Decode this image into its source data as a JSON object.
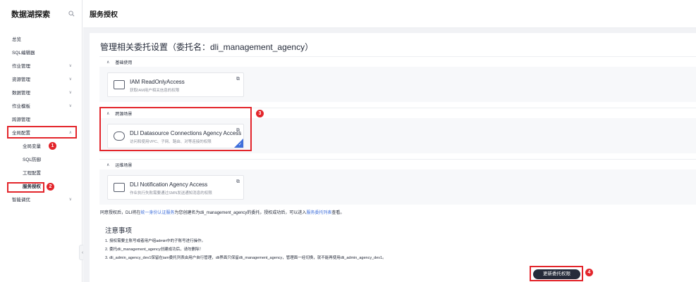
{
  "sidebar": {
    "title": "数据湖探索",
    "search_icon": "search-icon",
    "items": [
      {
        "label": "总览",
        "has_chevron": false
      },
      {
        "label": "SQL编辑器",
        "has_chevron": false
      },
      {
        "label": "作业管理",
        "has_chevron": true
      },
      {
        "label": "资源管理",
        "has_chevron": true
      },
      {
        "label": "数据管理",
        "has_chevron": true
      },
      {
        "label": "作业模板",
        "has_chevron": true
      },
      {
        "label": "跨源管理",
        "has_chevron": false
      },
      {
        "label": "全局配置",
        "has_chevron": true,
        "expanded": true
      },
      {
        "label": "全局变量",
        "sub": true
      },
      {
        "label": "SQL防御",
        "sub": true
      },
      {
        "label": "工程配置",
        "sub": true
      },
      {
        "label": "服务授权",
        "sub": true,
        "active": true
      },
      {
        "label": "智能调优",
        "has_chevron": true
      }
    ]
  },
  "page": {
    "title": "服务授权",
    "heading": "管理相关委托设置（委托名：dli_management_agency）"
  },
  "sections": [
    {
      "label": "基础使用",
      "card": {
        "title": "IAM ReadOnlyAccess",
        "desc": "获取IAM用户相关信息的权限",
        "icon": "id-card-icon",
        "selected": false
      }
    },
    {
      "label": "跨源场景",
      "card": {
        "title": "DLI Datasource Connections Agency Access",
        "desc": "访问和使用VPC、子网、路由、对等连接的权限",
        "icon": "cloud-icon",
        "selected": true
      }
    },
    {
      "label": "运维场景",
      "card": {
        "title": "DLI Notification Agency Access",
        "desc": "作业执行失败需要通过SMN发送通知消息的权限",
        "icon": "message-icon",
        "selected": false
      }
    }
  ],
  "info": {
    "prefix": "同意授权后，DLI将在",
    "link1": "统一身份认证服务",
    "middle": "为您创建名为dli_management_agency的委托，授权成功后，可以进入",
    "link2": "服务委托列表",
    "suffix": "查看。"
  },
  "notes": {
    "title": "注意事项",
    "items": [
      "1. 授权需要主账号或者用户组admin中的子账号进行操作。",
      "2. 委托dli_management_agency创建成功后，请勿删除！",
      "3. dli_admin_agency_dev1保留在iam委托列表由用户自行管理，dli界面只保留dli_management_agency，管理面一经切换，就不能再使用dli_admin_agency_dev1。"
    ]
  },
  "update_button": "更新委托权限",
  "markers": [
    "1",
    "2",
    "3",
    "4"
  ],
  "colors": {
    "annotation_red": "#e3252b",
    "link_blue": "#3f6fdb",
    "button_dark": "#252b3a"
  }
}
